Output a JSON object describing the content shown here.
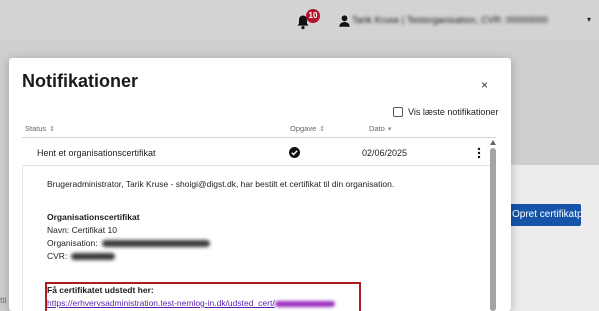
{
  "topbar": {
    "notification_count": "10",
    "user_label": "Tarik Kruse | Testorganisation, CVR: 00000000"
  },
  "background": {
    "button_label": "Opret certifikatprofil",
    "left_fragment": "tti"
  },
  "modal": {
    "title": "Notifikationer",
    "close_label": "×",
    "read_filter_label": "Vis læste notifikationer",
    "columns": {
      "status": "Status",
      "opgave": "Opgave",
      "dato": "Dato"
    },
    "row": {
      "title": "Hent et organisationscertifikat",
      "date": "02/06/2025"
    },
    "detail": {
      "intro": "Brugeradministrator, Tarik Kruse - shoigi@digst.dk, har bestilt et certifikat til din organisation.",
      "cert_heading": "Organisationscertifikat",
      "name_line": "Navn: Certifikat 10",
      "org_label": "Organisation:",
      "cvr_label": "CVR:",
      "fetch_label": "Få certifikatet udstedt her:",
      "fetch_link": "https://erhvervsadministration.test-nemlog-in.dk/udsted_cert/"
    }
  },
  "colors": {
    "badge": "#b3122d",
    "primary_button": "#1554a8",
    "highlight_border": "#b01c1c",
    "link": "#5a1fa8"
  }
}
